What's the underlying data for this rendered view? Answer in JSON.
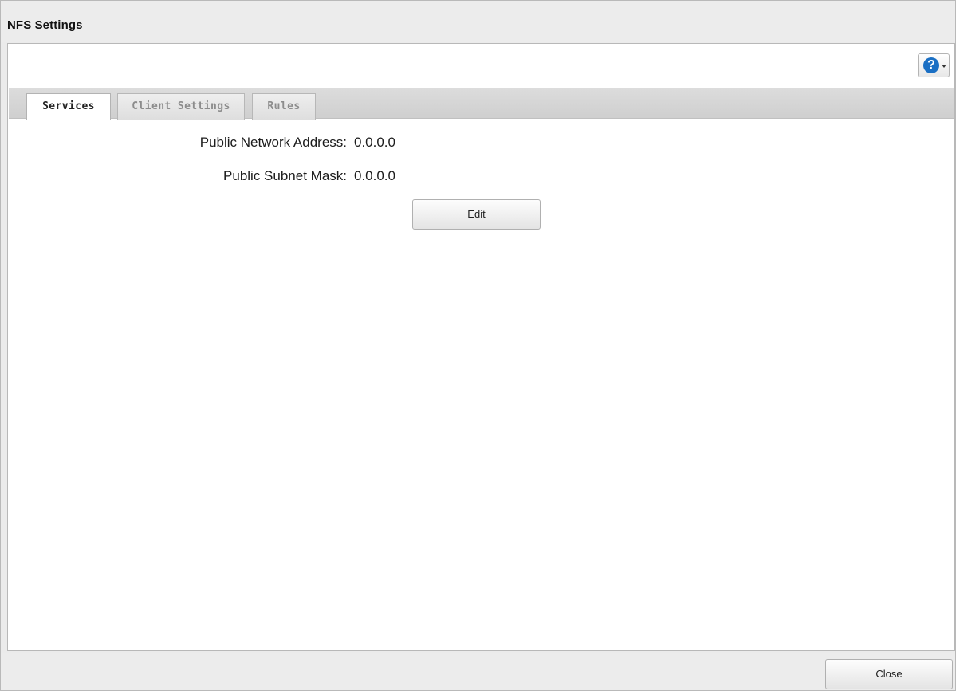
{
  "window": {
    "title": "NFS Settings"
  },
  "help": {
    "icon": "question-circle-icon",
    "glyph": "?",
    "accent_color": "#1a6fc4"
  },
  "tabs": [
    {
      "label": "Services",
      "active": true
    },
    {
      "label": "Client Settings",
      "active": false
    },
    {
      "label": "Rules",
      "active": false
    }
  ],
  "services": {
    "public_network_address": {
      "label": "Public Network Address:",
      "value": "0.0.0.0"
    },
    "public_subnet_mask": {
      "label": "Public Subnet Mask:",
      "value": "0.0.0.0"
    },
    "edit_label": "Edit"
  },
  "footer": {
    "close_label": "Close"
  }
}
